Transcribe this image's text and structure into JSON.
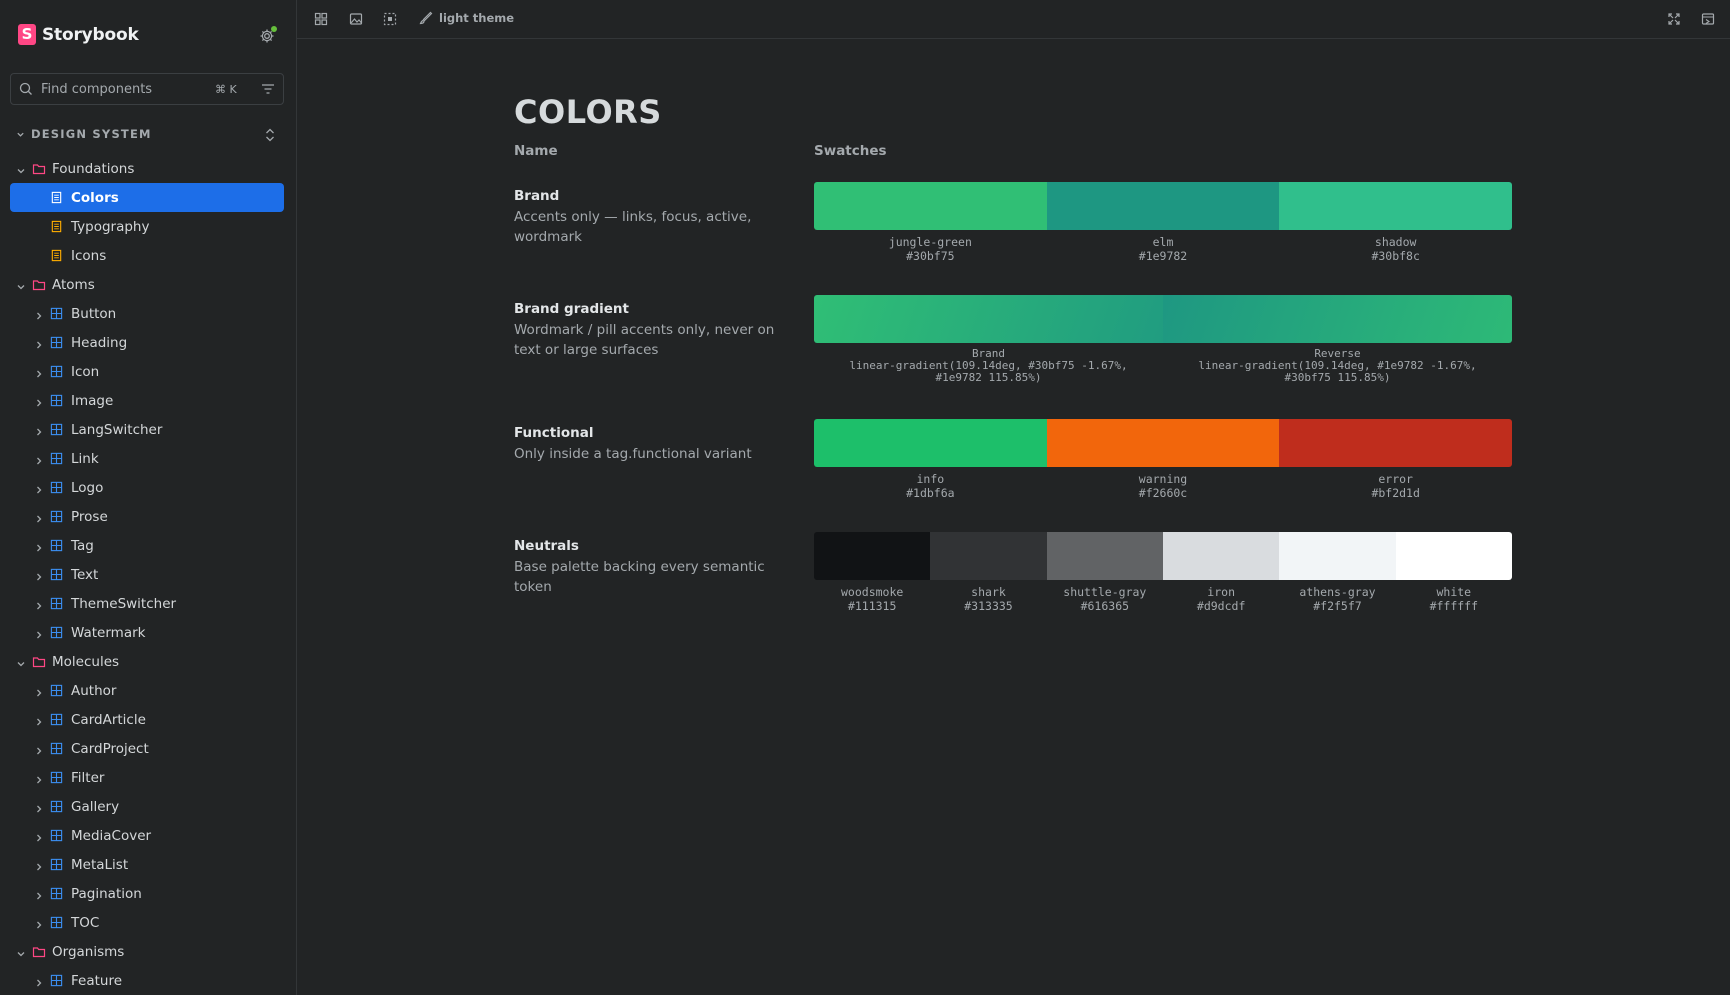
{
  "app": {
    "name": "Storybook",
    "logo_letter": "S"
  },
  "search": {
    "placeholder": "Find components",
    "shortcut": "⌘ K"
  },
  "sidebar": {
    "section_title": "DESIGN SYSTEM",
    "items": [
      {
        "label": "Foundations",
        "type": "folder",
        "level": 0
      },
      {
        "label": "Colors",
        "type": "doc",
        "level": 1,
        "selected": true
      },
      {
        "label": "Typography",
        "type": "doc",
        "level": 1
      },
      {
        "label": "Icons",
        "type": "doc",
        "level": 1
      },
      {
        "label": "Atoms",
        "type": "folder",
        "level": 0
      },
      {
        "label": "Button",
        "type": "component",
        "level": 1
      },
      {
        "label": "Heading",
        "type": "component",
        "level": 1
      },
      {
        "label": "Icon",
        "type": "component",
        "level": 1
      },
      {
        "label": "Image",
        "type": "component",
        "level": 1
      },
      {
        "label": "LangSwitcher",
        "type": "component",
        "level": 1
      },
      {
        "label": "Link",
        "type": "component",
        "level": 1
      },
      {
        "label": "Logo",
        "type": "component",
        "level": 1
      },
      {
        "label": "Prose",
        "type": "component",
        "level": 1
      },
      {
        "label": "Tag",
        "type": "component",
        "level": 1
      },
      {
        "label": "Text",
        "type": "component",
        "level": 1
      },
      {
        "label": "ThemeSwitcher",
        "type": "component",
        "level": 1
      },
      {
        "label": "Watermark",
        "type": "component",
        "level": 1
      },
      {
        "label": "Molecules",
        "type": "folder",
        "level": 0
      },
      {
        "label": "Author",
        "type": "component",
        "level": 1
      },
      {
        "label": "CardArticle",
        "type": "component",
        "level": 1
      },
      {
        "label": "CardProject",
        "type": "component",
        "level": 1
      },
      {
        "label": "Filter",
        "type": "component",
        "level": 1
      },
      {
        "label": "Gallery",
        "type": "component",
        "level": 1
      },
      {
        "label": "MediaCover",
        "type": "component",
        "level": 1
      },
      {
        "label": "MetaList",
        "type": "component",
        "level": 1
      },
      {
        "label": "Pagination",
        "type": "component",
        "level": 1
      },
      {
        "label": "TOC",
        "type": "component",
        "level": 1
      },
      {
        "label": "Organisms",
        "type": "folder",
        "level": 0
      },
      {
        "label": "Feature",
        "type": "component",
        "level": 1
      }
    ]
  },
  "toolbar": {
    "theme_label": "light theme"
  },
  "doc": {
    "title": "COLORS",
    "col_name": "Name",
    "col_swatches": "Swatches",
    "rows": [
      {
        "name": "Brand",
        "desc": "Accents only — links, focus, active, wordmark",
        "swatches": [
          {
            "name": "jungle-green",
            "hex": "#30bf75",
            "color": "#30bf75"
          },
          {
            "name": "elm",
            "hex": "#1e9782",
            "color": "#1e9782"
          },
          {
            "name": "shadow",
            "hex": "#30bf8c",
            "color": "#30bf8c"
          }
        ]
      },
      {
        "name": "Brand gradient",
        "desc": "Wordmark / pill accents only, never on text or large surfaces",
        "gradients": [
          {
            "name": "Brand",
            "value": "linear-gradient(109.14deg, #30bf75 -1.67%, #1e9782 115.85%)"
          },
          {
            "name": "Reverse",
            "value": "linear-gradient(109.14deg, #1e9782 -1.67%, #30bf75 115.85%)"
          }
        ]
      },
      {
        "name": "Functional",
        "desc": "Only inside a tag.functional variant",
        "swatches": [
          {
            "name": "info",
            "hex": "#1dbf6a",
            "color": "#1dbf6a"
          },
          {
            "name": "warning",
            "hex": "#f2660c",
            "color": "#f2660c"
          },
          {
            "name": "error",
            "hex": "#bf2d1d",
            "color": "#bf2d1d"
          }
        ]
      },
      {
        "name": "Neutrals",
        "desc": "Base palette backing every semantic token",
        "swatches": [
          {
            "name": "woodsmoke",
            "hex": "#111315",
            "color": "#111315"
          },
          {
            "name": "shark",
            "hex": "#313335",
            "color": "#313335"
          },
          {
            "name": "shuttle-gray",
            "hex": "#616365",
            "color": "#616365"
          },
          {
            "name": "iron",
            "hex": "#d9dcdf",
            "color": "#d9dcdf"
          },
          {
            "name": "athens-gray",
            "hex": "#f2f5f7",
            "color": "#f2f5f7"
          },
          {
            "name": "white",
            "hex": "#ffffff",
            "color": "#ffffff"
          }
        ]
      }
    ]
  }
}
